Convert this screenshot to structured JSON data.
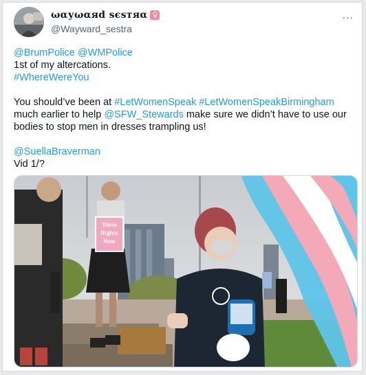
{
  "tweet": {
    "display_name": "ωαуωαяd ѕєѕтяα",
    "badge_icon": "female-sign-icon",
    "badge_color": "#f4899c",
    "handle": "@Wayward_sestra",
    "more_icon": "more-dots-icon",
    "more_label": "...",
    "link_color": "#1d9bf0",
    "line1": {
      "mention1": "@BrumPolice",
      "mention2": "@WMPolice"
    },
    "line2": "1st of my altercations.",
    "line3": {
      "hashtag": "#WhereWereYou"
    },
    "para2": {
      "t1": "You should’ve been at ",
      "hashtag1": "#LetWomenSpeak",
      "hashtag2": "#LetWomenSpeakBirmingham",
      "t2": "much earlier to help ",
      "mention": "@SFW_Stewards",
      "t3": " make sure we didn’t have to use our bodies to stop men in dresses trampling us!"
    },
    "para3": {
      "mention": "@SuellaBraverman",
      "vid": "Vid 1/?"
    },
    "media": {
      "sign_line1": "Trans",
      "sign_line2": "Rights",
      "sign_line3": "Now"
    }
  }
}
